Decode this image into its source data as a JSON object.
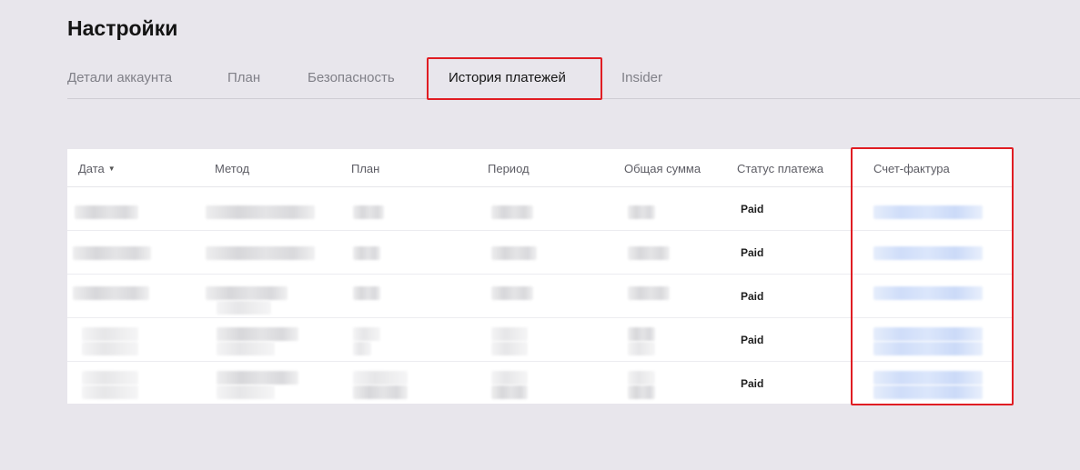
{
  "page": {
    "title": "Настройки"
  },
  "tabs": [
    {
      "label": "Детали аккаунта",
      "active": false
    },
    {
      "label": "План",
      "active": false
    },
    {
      "label": "Безопасность",
      "active": false
    },
    {
      "label": "История платежей",
      "active": true
    },
    {
      "label": "Insider",
      "active": false
    }
  ],
  "table": {
    "columns": [
      "Дата",
      "Метод",
      "План",
      "Период",
      "Общая сумма",
      "Статус платежа",
      "Счет-фактура"
    ],
    "sort_column": "Дата",
    "rows": [
      {
        "status": "Paid"
      },
      {
        "status": "Paid"
      },
      {
        "status": "Paid"
      },
      {
        "status": "Paid"
      },
      {
        "status": "Paid"
      }
    ]
  },
  "colors": {
    "highlight": "#e01d23",
    "background": "#e8e6ec",
    "table_bg": "#ffffff"
  }
}
